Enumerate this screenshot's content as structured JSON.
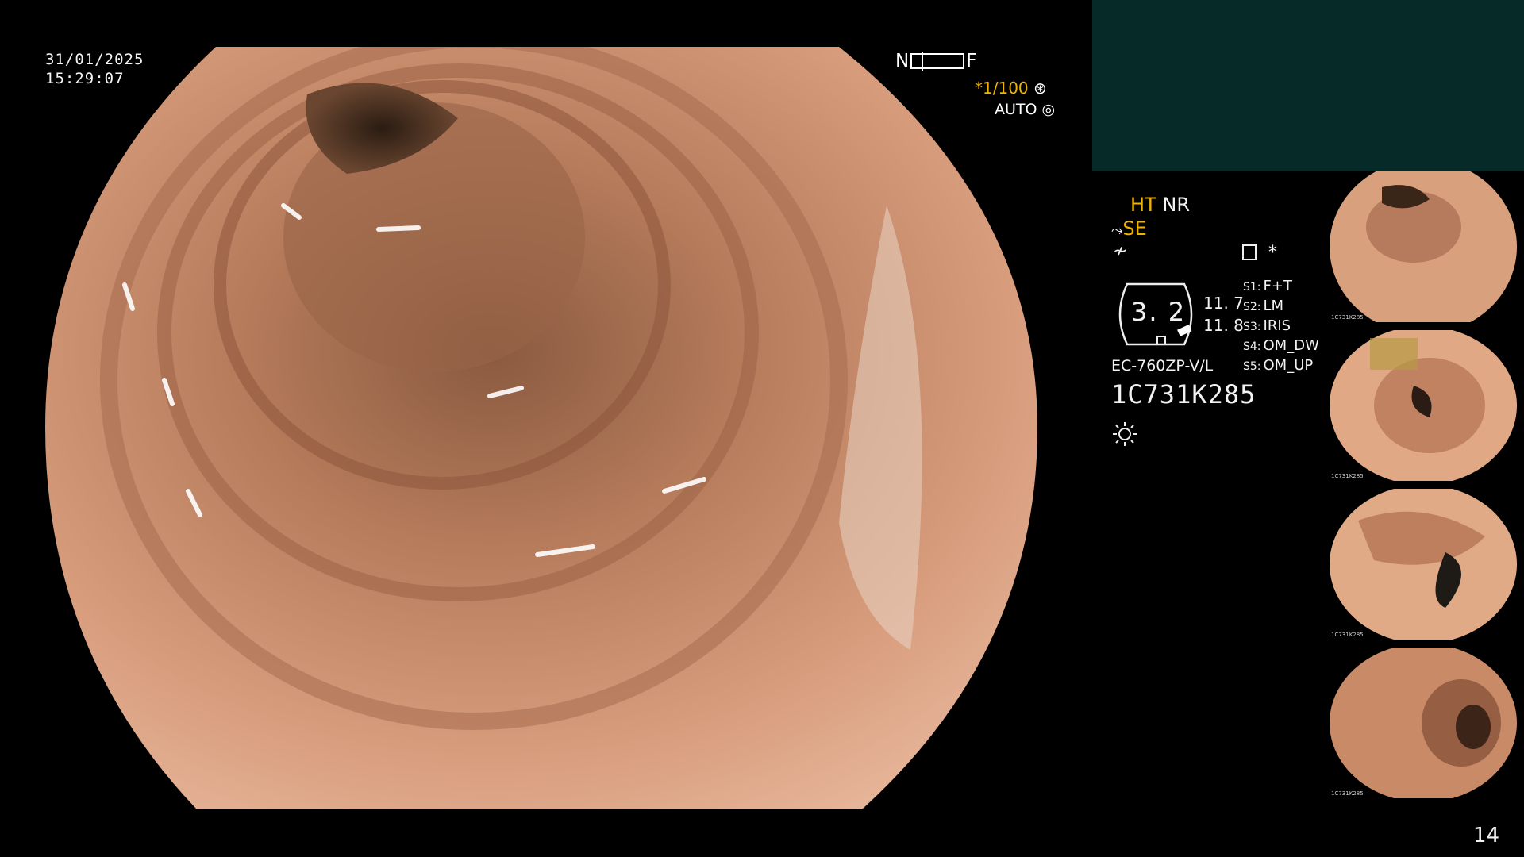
{
  "datetime": {
    "date": "31/01/2025",
    "time": "15:29:07"
  },
  "nf_scale": {
    "near": "N",
    "far": "F"
  },
  "shutter": {
    "prefix": "*",
    "value": "1/100"
  },
  "exposure": {
    "mode": "AUTO"
  },
  "status": {
    "ht": "HT",
    "nr": "NR",
    "se": "SE"
  },
  "scope": {
    "value": "3. 2",
    "side_top": "11. 7",
    "side_bottom": "11. 8"
  },
  "presets": [
    {
      "key": "S1:",
      "value": "F+T"
    },
    {
      "key": "S2:",
      "value": "LM"
    },
    {
      "key": "S3:",
      "value": "IRIS"
    },
    {
      "key": "S4:",
      "value": "OM_DW"
    },
    {
      "key": "S5:",
      "value": "OM_UP"
    }
  ],
  "device": {
    "model": "EC-760ZP-V/L",
    "serial": "1C731K285"
  },
  "thumbnails": [
    {
      "caption": "1C731K285"
    },
    {
      "caption": "1C731K285"
    },
    {
      "caption": "1C731K285"
    },
    {
      "caption": "1C731K285"
    }
  ],
  "page_number": "14",
  "colors": {
    "accent_yellow": "#f0b400",
    "panel_teal": "#062a27",
    "mucosa": "#c98a68"
  },
  "icons": [
    "shutter-icon",
    "auto-exposure-icon",
    "structure-enhance-icon",
    "flash-icon",
    "record-icon",
    "sun-icon"
  ]
}
